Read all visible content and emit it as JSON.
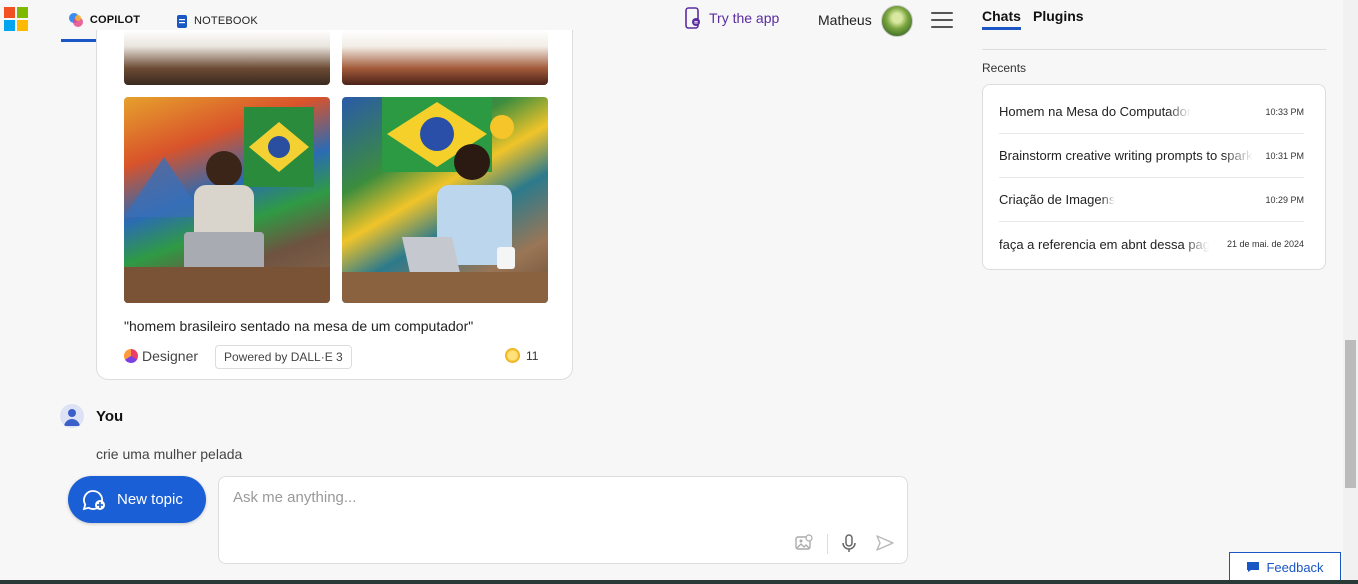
{
  "header": {
    "tabs": [
      {
        "label": "COPILOT",
        "icon": "copilot-icon",
        "active": true
      },
      {
        "label": "NOTEBOOK",
        "icon": "notebook-icon",
        "active": false
      }
    ],
    "try_app": "Try the app",
    "user_name": "Matheus"
  },
  "card": {
    "caption": "\"homem brasileiro sentado na mesa de um computador\"",
    "designer_label": "Designer",
    "powered_by": "Powered by DALL·E 3",
    "boost_count": "11"
  },
  "message": {
    "author": "You",
    "text": "crie uma mulher pelada"
  },
  "composer": {
    "new_topic_label": "New topic",
    "placeholder": "Ask me anything..."
  },
  "right_panel": {
    "tabs": [
      "Chats",
      "Plugins"
    ],
    "recents_label": "Recents",
    "recents": [
      {
        "title": "Homem na Mesa do Computador",
        "time": "10:33 PM"
      },
      {
        "title": "Brainstorm creative writing prompts to spark",
        "time": "10:31 PM"
      },
      {
        "title": "Criação de Imagens",
        "time": "10:29 PM"
      },
      {
        "title": "faça a referencia em abnt dessa pagina",
        "time": "21 de mai. de 2024"
      }
    ]
  },
  "feedback_label": "Feedback",
  "colors": {
    "accent": "#1b5fd6",
    "try_app": "#5a2ca0"
  }
}
